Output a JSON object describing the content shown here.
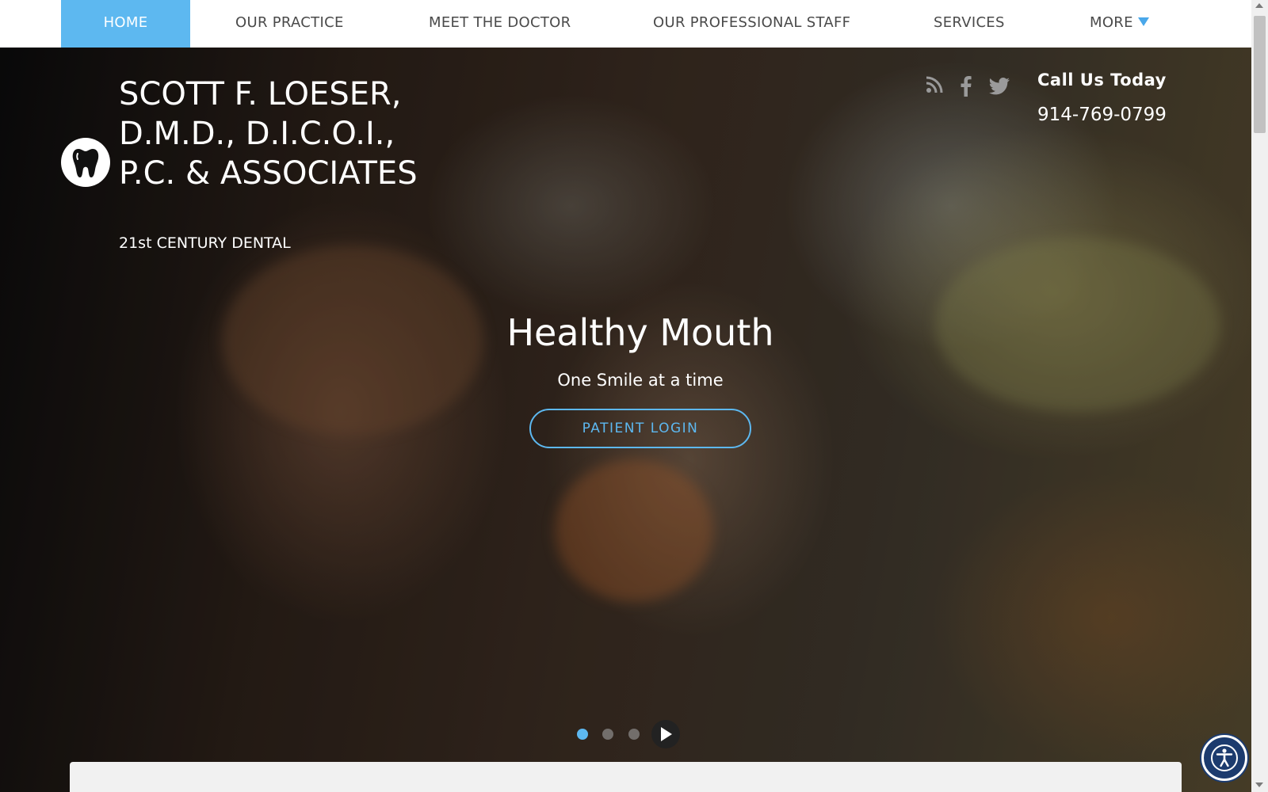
{
  "nav": {
    "items": [
      {
        "label": "HOME",
        "active": true
      },
      {
        "label": "OUR PRACTICE"
      },
      {
        "label": "MEET THE DOCTOR"
      },
      {
        "label": "OUR PROFESSIONAL STAFF"
      },
      {
        "label": "SERVICES"
      },
      {
        "label": "MORE"
      }
    ],
    "more_icon": "triangle-down-icon",
    "accent_color": "#5db8f0"
  },
  "brand": {
    "logo_icon": "tooth-icon",
    "title": "SCOTT F. LOESER, D.M.D., D.I.C.O.I., P.C. & ASSOCIATES",
    "subtitle": "21st CENTURY DENTAL"
  },
  "social": {
    "icons": [
      "rss-icon",
      "facebook-icon",
      "twitter-icon"
    ]
  },
  "contact": {
    "call_label": "Call Us Today",
    "phone": "914-769-0799"
  },
  "hero": {
    "headline": "Healthy Mouth",
    "tagline": "One Smile at a time",
    "button_label": "PATIENT LOGIN",
    "slides_total": 3,
    "active_slide": 1,
    "play_icon": "play-icon"
  },
  "accessibility": {
    "icon": "accessibility-icon",
    "color": "#1c3b6e"
  }
}
